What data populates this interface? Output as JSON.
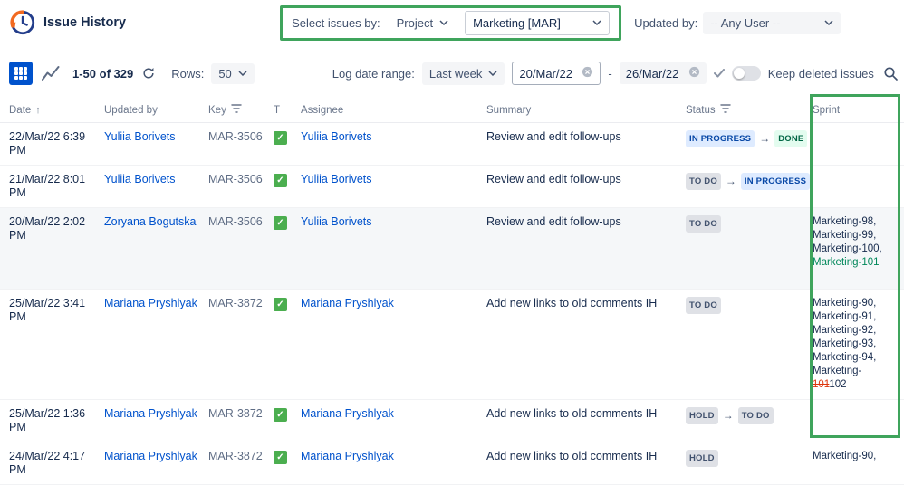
{
  "colors": {
    "annotation_green": "#3fa45c",
    "link_blue": "#0052cc",
    "primary_button_blue": "#0052cc",
    "badge_inprogress_bg": "#deebff",
    "badge_inprogress_text": "#0747a6",
    "badge_done_bg": "#e3fcef",
    "badge_done_text": "#006644",
    "badge_todo_bg": "#dfe1e6",
    "badge_todo_text": "#42526e",
    "task_icon_green": "#4bae4f",
    "sprint_added_text": "#00875a",
    "sprint_removed_text": "#de350b"
  },
  "icons": {
    "sort_asc": "↑",
    "task_check": "✓",
    "status_arrow": "→"
  },
  "header": {
    "app_title": "Issue History",
    "select_issues_label": "Select issues by:",
    "select_by_value": "Project",
    "project_value": "Marketing [MAR]",
    "updated_by_label": "Updated by:",
    "updated_by_value": "-- Any User --"
  },
  "toolbar": {
    "range_text": "1-50 of 329",
    "rows_label": "Rows:",
    "rows_value": "50",
    "log_date_range_label": "Log date range:",
    "date_preset_value": "Last week",
    "date_from": "20/Mar/22",
    "date_separator": "-",
    "date_to": "26/Mar/22",
    "keep_deleted_label": "Keep deleted issues"
  },
  "table": {
    "columns": [
      "Date",
      "Updated by",
      "Key",
      "T",
      "Assignee",
      "Summary",
      "Status",
      "Sprint"
    ],
    "rows": [
      {
        "date": "22/Mar/22 6:39 PM",
        "updated_by": "Yuliia Borivets",
        "key": "MAR-3506",
        "type": "task",
        "assignee": "Yuliia Borivets",
        "summary": "Review and edit follow-ups",
        "status_from": "IN PROGRESS",
        "status_to": "DONE",
        "sprint_lines": [],
        "shaded": false
      },
      {
        "date": "21/Mar/22 8:01 PM",
        "updated_by": "Yuliia Borivets",
        "key": "MAR-3506",
        "type": "task",
        "assignee": "Yuliia Borivets",
        "summary": "Review and edit follow-ups",
        "status_from": "TO DO",
        "status_to": "IN PROGRESS",
        "sprint_lines": [],
        "shaded": false
      },
      {
        "date": "20/Mar/22 2:02 PM",
        "updated_by": "Zoryana Bogutska",
        "key": "MAR-3506",
        "type": "task",
        "assignee": "Yuliia Borivets",
        "summary": "Review and edit follow-ups",
        "status_from": "TO DO",
        "status_to": null,
        "shaded": true,
        "sprint_lines": [
          [
            {
              "text": "Marketing-98,",
              "style": "normal"
            }
          ],
          [
            {
              "text": "Marketing-99,",
              "style": "normal"
            }
          ],
          [
            {
              "text": "Marketing-100,",
              "style": "normal"
            }
          ],
          [
            {
              "text": "Marketing-101",
              "style": "added"
            }
          ]
        ]
      },
      {
        "date": "25/Mar/22 3:41 PM",
        "updated_by": "Mariana Pryshlyak",
        "key": "MAR-3872",
        "type": "task",
        "assignee": "Mariana Pryshlyak",
        "summary": "Add new links to old comments IH",
        "status_from": "TO DO",
        "status_to": null,
        "shaded": false,
        "sprint_lines": [
          [
            {
              "text": "Marketing-90,",
              "style": "normal"
            }
          ],
          [
            {
              "text": "Marketing-91,",
              "style": "normal"
            }
          ],
          [
            {
              "text": "Marketing-92,",
              "style": "normal"
            }
          ],
          [
            {
              "text": "Marketing-93,",
              "style": "normal"
            }
          ],
          [
            {
              "text": "Marketing-94,",
              "style": "normal"
            }
          ],
          [
            {
              "text": "Marketing-",
              "style": "normal"
            },
            {
              "text": "101",
              "style": "removed"
            },
            {
              "text": "102",
              "style": "normal"
            }
          ]
        ]
      },
      {
        "date": "25/Mar/22 1:36 PM",
        "updated_by": "Mariana Pryshlyak",
        "key": "MAR-3872",
        "type": "task",
        "assignee": "Mariana Pryshlyak",
        "summary": "Add new links to old comments IH",
        "status_from": "HOLD",
        "status_to": "TO DO",
        "sprint_lines": [],
        "shaded": false
      },
      {
        "date": "24/Mar/22 4:17 PM",
        "updated_by": "Mariana Pryshlyak",
        "key": "MAR-3872",
        "type": "task",
        "assignee": "Mariana Pryshlyak",
        "summary": "Add new links to old comments IH",
        "status_from": "HOLD",
        "status_to": null,
        "shaded": false,
        "sprint_lines": [
          [
            {
              "text": "Marketing-90,",
              "style": "normal"
            }
          ]
        ]
      }
    ]
  }
}
